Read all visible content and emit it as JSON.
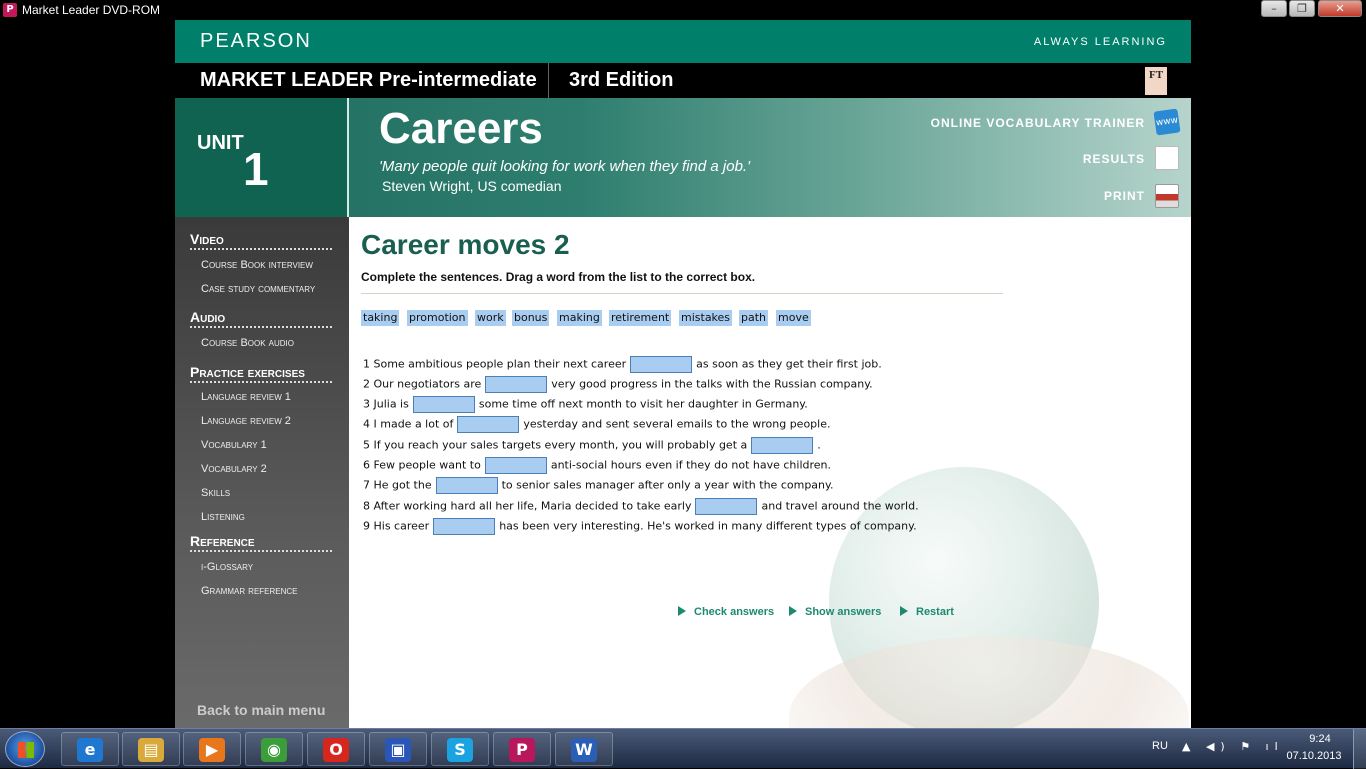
{
  "window": {
    "title": "Market Leader DVD-ROM",
    "icon_letter": "P",
    "min": "–",
    "max": "❐",
    "close": "✕"
  },
  "brand": {
    "logo": "PEARSON",
    "tagline": "ALWAYS LEARNING"
  },
  "course": {
    "name": "MARKET LEADER Pre-intermediate",
    "edition": "3rd Edition",
    "ft": "FT"
  },
  "unit": {
    "label": "UNIT",
    "number": "1",
    "title": "Careers",
    "quote": "'Many people quit looking for work when they find a job.'",
    "author": "Steven Wright, US comedian"
  },
  "header_links": {
    "vocab_trainer": "ONLINE VOCABULARY TRAINER",
    "results": "RESULTS",
    "print": "PRINT"
  },
  "sidebar": {
    "video": {
      "title": "Video",
      "items": [
        "Course Book interview",
        "Case study commentary"
      ]
    },
    "audio": {
      "title": "Audio",
      "items": [
        "Course Book audio"
      ]
    },
    "practice": {
      "title": "Practice exercises",
      "items": [
        "Language review 1",
        "Language review 2",
        "Vocabulary 1",
        "Vocabulary 2",
        "Skills",
        "Listening"
      ]
    },
    "reference": {
      "title": "Reference",
      "items": [
        "i-Glossary",
        "Grammar reference"
      ]
    },
    "back": "Back to main menu"
  },
  "exercise": {
    "title": "Career moves 2",
    "instruction": "Complete the sentences. Drag a word from the list to the correct box.",
    "words": [
      "taking",
      "promotion",
      "work",
      "bonus",
      "making",
      "retirement",
      "mistakes",
      "path",
      "move"
    ],
    "sentences": [
      {
        "before": "1 Some ambitious people plan their next career",
        "after": "as soon as they get their first job."
      },
      {
        "before": "2 Our negotiators are",
        "after": "very good progress in the talks with the Russian company."
      },
      {
        "before": "3 Julia is",
        "after": "some time off next month to visit her daughter in Germany."
      },
      {
        "before": "4 I made a lot of",
        "after": "yesterday and sent several emails to the wrong people."
      },
      {
        "before": "5 If you reach your sales targets every month, you will probably get a",
        "after": "."
      },
      {
        "before": "6 Few people want to",
        "after": "anti-social hours even if they do not have children."
      },
      {
        "before": "7 He got the",
        "after": "to senior sales manager after only a year with the company."
      },
      {
        "before": "8 After working hard all her life, Maria decided to take early",
        "after": "and travel around the world."
      },
      {
        "before": "9 His career",
        "after": "has been very interesting. He's worked in many different types of company."
      }
    ],
    "actions": {
      "check": "Check answers",
      "show": "Show answers",
      "restart": "Restart"
    }
  },
  "taskbar": {
    "lang": "RU",
    "tray": "▲ ◀) ⚑ ıl",
    "time": "9:24",
    "date": "07.10.2013",
    "apps": [
      {
        "label": "e",
        "color": "#1e78d2"
      },
      {
        "label": "▤",
        "color": "#d9a93a"
      },
      {
        "label": "▶",
        "color": "#e8761a"
      },
      {
        "label": "◉",
        "color": "#3b9e3b"
      },
      {
        "label": "O",
        "color": "#d7261e"
      },
      {
        "label": "▣",
        "color": "#2a56b8"
      },
      {
        "label": "S",
        "color": "#1aa3e0"
      },
      {
        "label": "P",
        "color": "#b8185b"
      },
      {
        "label": "W",
        "color": "#2b5fb5"
      }
    ]
  }
}
